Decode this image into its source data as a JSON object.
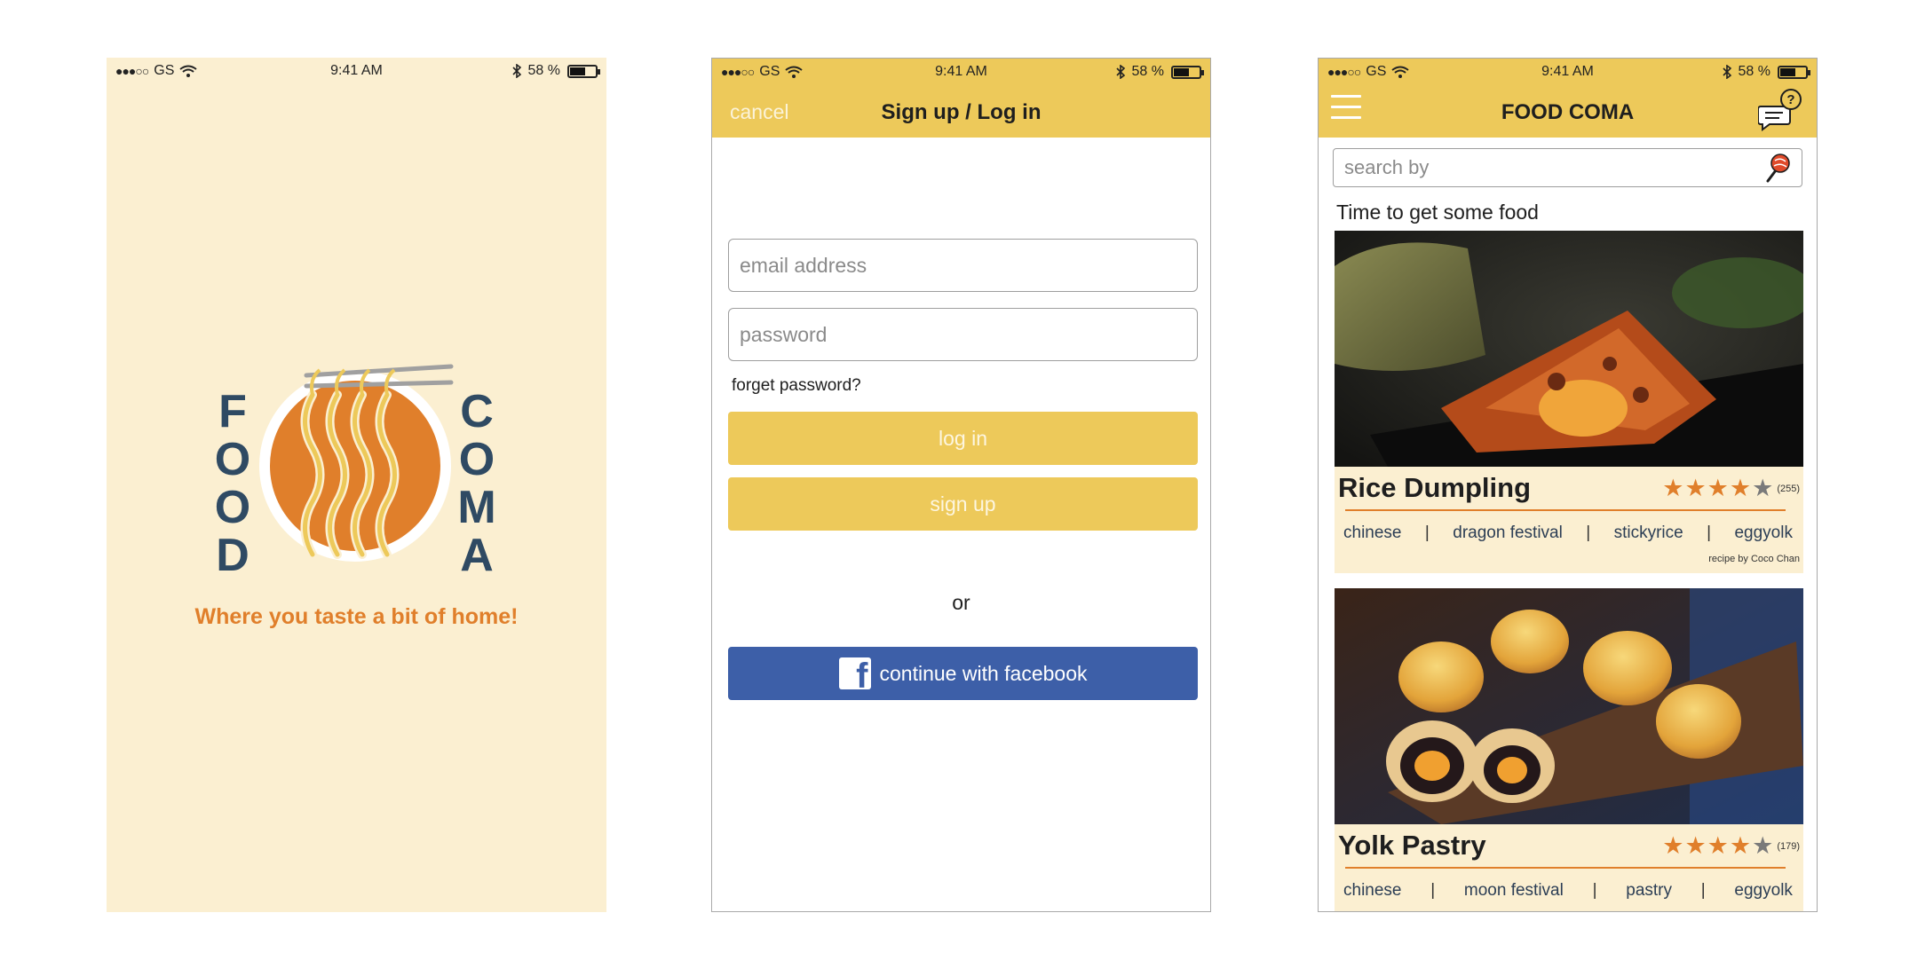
{
  "status_bar": {
    "carrier": "GS",
    "time": "9:41 AM",
    "battery": "58 %",
    "battery_level": 0.58
  },
  "splash": {
    "logo_left": [
      "F",
      "O",
      "O",
      "D"
    ],
    "logo_right": [
      "C",
      "O",
      "M",
      "A"
    ],
    "tagline": "Where you taste a bit of home!"
  },
  "login": {
    "cancel": "cancel",
    "title": "Sign up / Log in",
    "email_placeholder": "email address",
    "password_placeholder": "password",
    "forget": "forget password?",
    "login_label": "log in",
    "signup_label": "sign up",
    "or": "or",
    "facebook_label": "continue with facebook"
  },
  "home": {
    "title": "FOOD COMA",
    "search_placeholder": "search by",
    "section_title": "Time to get some food",
    "cards": [
      {
        "name": "Rice Dumpling",
        "rating": 4,
        "count": "(255)",
        "tags": [
          "chinese",
          "dragon festival",
          "stickyrice",
          "eggyolk"
        ],
        "credit": "recipe by Coco Chan"
      },
      {
        "name": "Yolk Pastry",
        "rating": 4,
        "count": "(179)",
        "tags": [
          "chinese",
          "moon festival",
          "pastry",
          "eggyolk"
        ]
      }
    ]
  },
  "colors": {
    "splash_bg": "#fbefd1",
    "accent_yellow": "#edc95a",
    "accent_orange": "#e07f2b",
    "logo_navy": "#2f4a63",
    "facebook_blue": "#3d5fa8"
  },
  "icons": [
    "wifi-icon",
    "bluetooth-icon",
    "battery-icon",
    "hamburger-icon",
    "help-chat-icon",
    "lollipop-search-icon",
    "facebook-icon",
    "star-icon"
  ]
}
